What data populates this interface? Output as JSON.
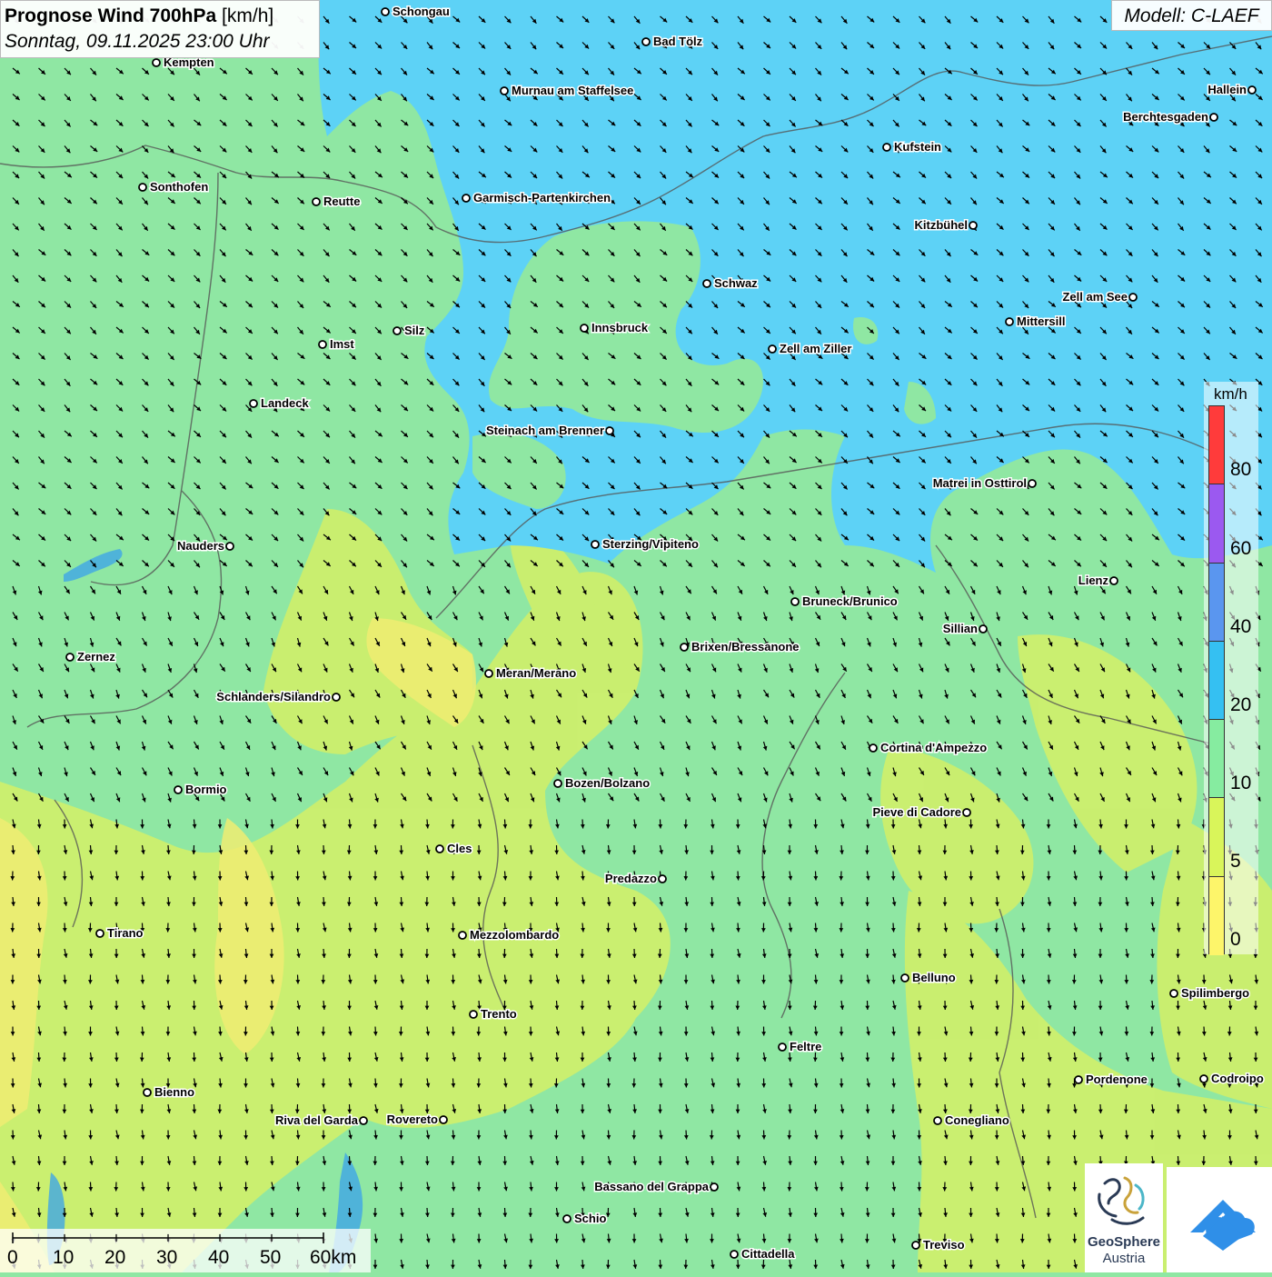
{
  "header": {
    "title_bold": "Prognose Wind 700hPa",
    "title_unit": "[km/h]",
    "subtitle": "Sonntag, 09.11.2025 23:00 Uhr",
    "model": "Modell: C-LAEF"
  },
  "legend": {
    "unit": "km/h",
    "ticks": [
      "80",
      "60",
      "40",
      "20",
      "10",
      "5",
      "0"
    ],
    "bands": [
      {
        "color": "#ff3b3b"
      },
      {
        "color": "#9b59f0"
      },
      {
        "color": "#5a96ef"
      },
      {
        "color": "#35c0f2"
      },
      {
        "color": "#86eca0"
      },
      {
        "color": "#d9f55a"
      },
      {
        "color": "#fdf56a"
      }
    ]
  },
  "colors": {
    "band_20_40": "#5dd2f6",
    "band_10_20": "#8fe7a3",
    "band_5_10": "#d0ef6a",
    "band_0_5": "#f2ee6e",
    "arrow": "#000000"
  },
  "scale_bar": {
    "labels": [
      "0",
      "10",
      "20",
      "30",
      "40",
      "50",
      "60km"
    ]
  },
  "cities": [
    {
      "name": "Schongau"
    },
    {
      "name": "Bad Tölz"
    },
    {
      "name": "Kempten"
    },
    {
      "name": "Murnau am Staffelsee"
    },
    {
      "name": "Hallein"
    },
    {
      "name": "Berchtesgaden"
    },
    {
      "name": "Kufstein"
    },
    {
      "name": "Sonthofen"
    },
    {
      "name": "Reutte"
    },
    {
      "name": "Garmisch-Partenkirchen"
    },
    {
      "name": "Kitzbühel"
    },
    {
      "name": "Schwaz"
    },
    {
      "name": "Zell am See"
    },
    {
      "name": "Mittersill"
    },
    {
      "name": "Innsbruck"
    },
    {
      "name": "Silz"
    },
    {
      "name": "Imst"
    },
    {
      "name": "Zell am Ziller"
    },
    {
      "name": "Landeck"
    },
    {
      "name": "Steinach am Brenner"
    },
    {
      "name": "Matrei in Osttirol"
    },
    {
      "name": "Nauders"
    },
    {
      "name": "Sterzing/Vipiteno"
    },
    {
      "name": "Lienz"
    },
    {
      "name": "Bruneck/Brunico"
    },
    {
      "name": "Sillian"
    },
    {
      "name": "Brixen/Bressanone"
    },
    {
      "name": "Zernez"
    },
    {
      "name": "Meran/Merano"
    },
    {
      "name": "Schlanders/Silandro"
    },
    {
      "name": "Cortina d'Ampezzo"
    },
    {
      "name": "Bozen/Bolzano"
    },
    {
      "name": "Bormio"
    },
    {
      "name": "Pieve di Cadore"
    },
    {
      "name": "Cles"
    },
    {
      "name": "Predazzo"
    },
    {
      "name": "Tirano"
    },
    {
      "name": "Mezzolombardo"
    },
    {
      "name": "Belluno"
    },
    {
      "name": "Spilimbergo"
    },
    {
      "name": "Trento"
    },
    {
      "name": "Feltre"
    },
    {
      "name": "Pordenone"
    },
    {
      "name": "Codroipo"
    },
    {
      "name": "Bienno"
    },
    {
      "name": "Riva del Garda"
    },
    {
      "name": "Rovereto"
    },
    {
      "name": "Conegliano"
    },
    {
      "name": "Bassano del Grappa"
    },
    {
      "name": "Schio"
    },
    {
      "name": "Treviso"
    },
    {
      "name": "Cittadella"
    }
  ],
  "logos": {
    "geosphere_line1": "GeoSphere",
    "geosphere_line2": "Austria"
  }
}
